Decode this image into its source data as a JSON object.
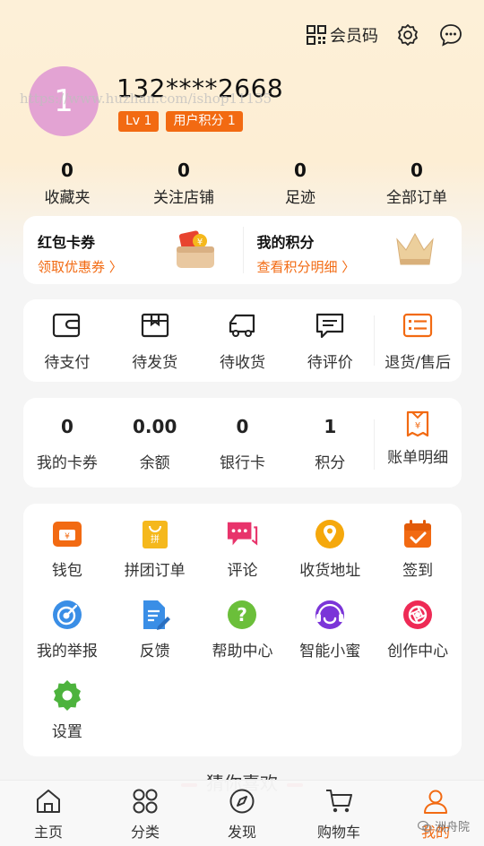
{
  "topbar": {
    "member_code_label": "会员码"
  },
  "profile": {
    "avatar_initial": "1",
    "username": "132****2668",
    "watermark": "https://www.huzhan.com/ishop11135",
    "level_badge": "Lv 1",
    "points_badge": "用户积分 1"
  },
  "stats": [
    {
      "value": "0",
      "label": "收藏夹"
    },
    {
      "value": "0",
      "label": "关注店铺"
    },
    {
      "value": "0",
      "label": "足迹"
    },
    {
      "value": "0",
      "label": "全部订单"
    }
  ],
  "promo": {
    "coupon_title": "红包卡券",
    "coupon_link": "领取优惠券 〉",
    "points_title": "我的积分",
    "points_link": "查看积分明细 〉"
  },
  "orders": [
    {
      "label": "待支付",
      "icon": "wallet-icon"
    },
    {
      "label": "待发货",
      "icon": "package-icon"
    },
    {
      "label": "待收货",
      "icon": "truck-icon"
    },
    {
      "label": "待评价",
      "icon": "comment-icon"
    },
    {
      "label": "退货/售后",
      "icon": "return-list-icon"
    }
  ],
  "assets": [
    {
      "value": "0",
      "label": "我的卡券"
    },
    {
      "value": "0.00",
      "label": "余额"
    },
    {
      "value": "0",
      "label": "银行卡"
    },
    {
      "value": "1",
      "label": "积分"
    },
    {
      "label": "账单明细",
      "icon": "bill-icon"
    }
  ],
  "tools": [
    {
      "label": "钱包",
      "icon": "wallet-icon",
      "color": "#f26a12"
    },
    {
      "label": "拼团订单",
      "icon": "group-bag-icon",
      "color": "#f5b81c"
    },
    {
      "label": "评论",
      "icon": "chat-icon",
      "color": "#e8336b"
    },
    {
      "label": "收货地址",
      "icon": "location-icon",
      "color": "#f5a80c"
    },
    {
      "label": "签到",
      "icon": "calendar-check-icon",
      "color": "#f26a12"
    },
    {
      "label": "我的举报",
      "icon": "report-icon",
      "color": "#3a8ee6"
    },
    {
      "label": "反馈",
      "icon": "feedback-icon",
      "color": "#3a8ee6"
    },
    {
      "label": "帮助中心",
      "icon": "help-icon",
      "color": "#6bbf3a"
    },
    {
      "label": "智能小蜜",
      "icon": "assistant-icon",
      "color": "#7b35d8"
    },
    {
      "label": "创作中心",
      "icon": "creation-icon",
      "color": "#ee2a55"
    },
    {
      "label": "设置",
      "icon": "settings-icon",
      "color": "#4db33d"
    }
  ],
  "guess_title": "猜你喜欢",
  "tabs": [
    {
      "label": "主页",
      "icon": "home-icon"
    },
    {
      "label": "分类",
      "icon": "category-icon"
    },
    {
      "label": "发现",
      "icon": "compass-icon"
    },
    {
      "label": "购物车",
      "icon": "cart-icon"
    },
    {
      "label": "我的",
      "icon": "user-icon",
      "active": true
    }
  ],
  "corner_mark": "洲舟院",
  "colors": {
    "accent": "#f26a12",
    "header_bg": "#fdf0d8"
  }
}
